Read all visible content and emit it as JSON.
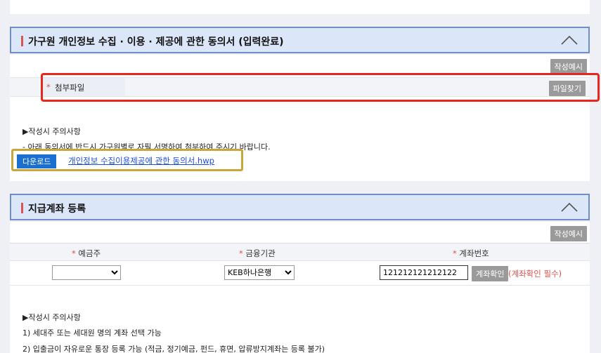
{
  "consent": {
    "title": "가구원 개인정보 수집 · 이용 · 제공에 관한 동의서 (입력완료)",
    "example_button": "작성예시",
    "attach_label": "첨부파일",
    "required_mark": "*",
    "find_file_button": "파일찾기",
    "notice_title": "▶작성시 주의사항",
    "notice_line": "- 아래 동의서에 반드시 가구원별로 자필 서명하여 첨부하여 주시기 바랍니다.",
    "download_button": "다운로드",
    "download_link": "개인정보 수집이용제공에 관한 동의서.hwp"
  },
  "account": {
    "title": "지급계좌 등록",
    "example_button": "작성예시",
    "col_depositor": "예금주",
    "col_bank": "금융기관",
    "col_account": "계좌번호",
    "depositor_value": "",
    "bank_value": "KEB하나은행",
    "account_value": "121212121212122",
    "verify_button": "계좌확인",
    "verify_required": "(계좌확인 필수)",
    "notice_title": "▶작성시 주의사항",
    "notice_1": "1) 세대주 또는 세대원 명의 계좌 선택 가능",
    "notice_2": "2) 입출금이 자유로운 통장 등록 가능 (적금, 정기예금, 펀드, 휴면, 압류방지계좌는 등록 불가)"
  },
  "colors": {
    "accent_red": "#d9534f",
    "header_bg": "#dbe6f8",
    "header_border": "#6f8fc4",
    "download_blue": "#1b6fd1",
    "highlight_red": "#e8261b",
    "highlight_gold": "#c9a63c"
  }
}
